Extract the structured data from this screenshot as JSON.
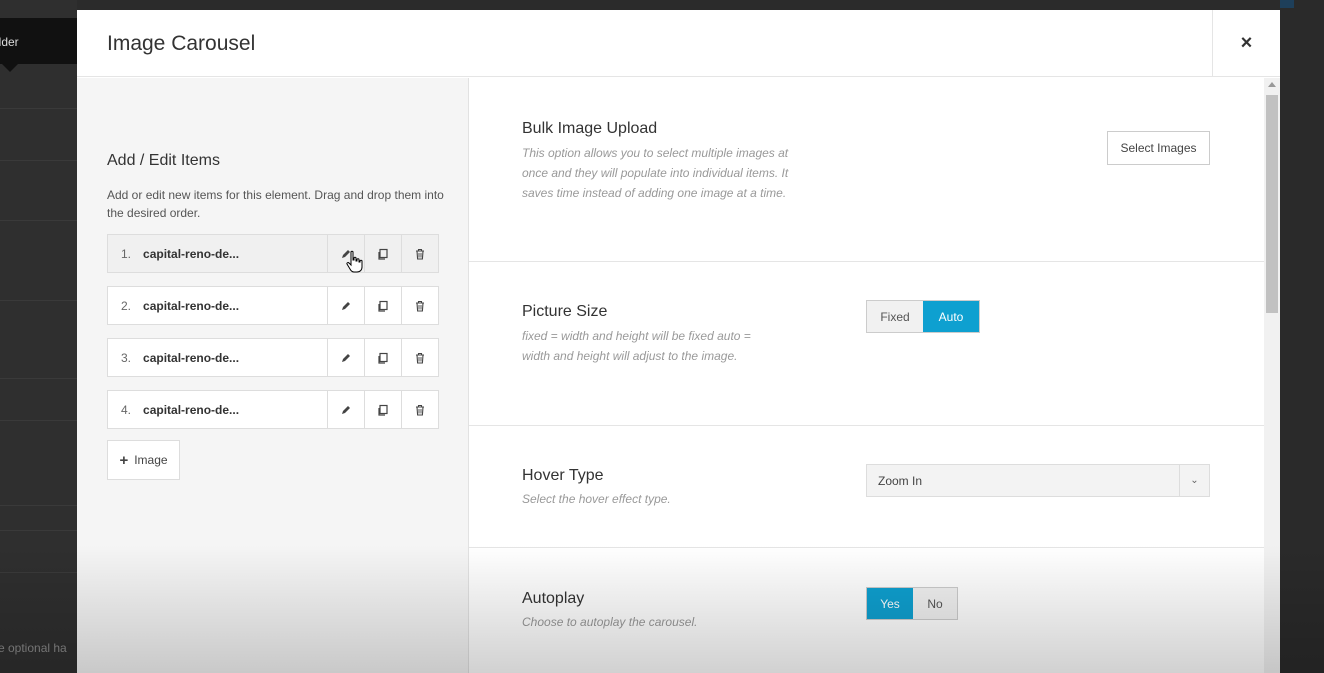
{
  "background": {
    "tooltip_text": "ilder",
    "bottom_text": "re optional ha"
  },
  "modal": {
    "title": "Image Carousel",
    "close_label": "×"
  },
  "left_panel": {
    "heading": "Add / Edit Items",
    "description": "Add or edit new items for this element. Drag and drop them into the desired order.",
    "items": [
      {
        "number": "1.",
        "name": "capital-reno-de..."
      },
      {
        "number": "2.",
        "name": "capital-reno-de..."
      },
      {
        "number": "3.",
        "name": "capital-reno-de..."
      },
      {
        "number": "4.",
        "name": "capital-reno-de..."
      }
    ],
    "add_button": {
      "plus": "+",
      "label": "Image"
    }
  },
  "settings": {
    "bulk_upload": {
      "title": "Bulk Image Upload",
      "description": "This option allows you to select multiple images at once and they will populate into individual items. It saves time instead of adding one image at a time.",
      "button_label": "Select Images"
    },
    "picture_size": {
      "title": "Picture Size",
      "description": "fixed = width and height will be fixed auto = width and height will adjust to the image.",
      "options": [
        "Fixed",
        "Auto"
      ],
      "selected": "Auto"
    },
    "hover_type": {
      "title": "Hover Type",
      "description": "Select the hover effect type.",
      "selected": "Zoom In"
    },
    "autoplay": {
      "title": "Autoplay",
      "description": "Choose to autoplay the carousel.",
      "options": [
        "Yes",
        "No"
      ],
      "selected": "Yes"
    }
  },
  "colors": {
    "accent": "#0ea0d0",
    "panel_bg": "#f5f5f5",
    "backdrop": "#2b2b2b"
  }
}
